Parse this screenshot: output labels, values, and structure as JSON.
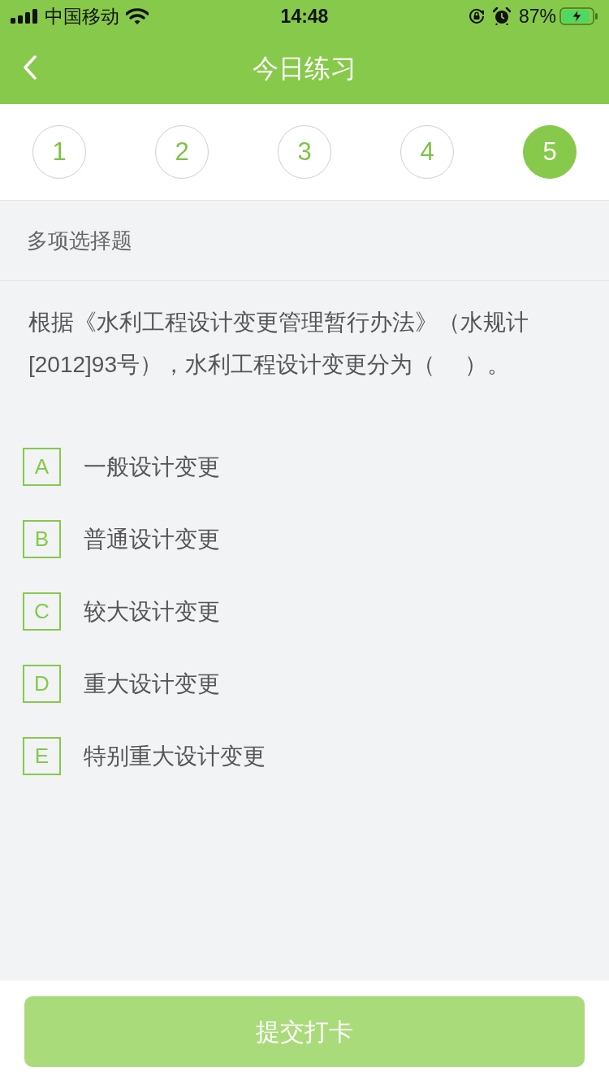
{
  "status_bar": {
    "carrier": "中国移动",
    "time": "14:48",
    "battery": "87%"
  },
  "nav": {
    "title": "今日练习"
  },
  "question_tabs": [
    {
      "label": "1",
      "selected": false
    },
    {
      "label": "2",
      "selected": false
    },
    {
      "label": "3",
      "selected": false
    },
    {
      "label": "4",
      "selected": false
    },
    {
      "label": "5",
      "selected": true
    }
  ],
  "question": {
    "type_label": "多项选择题",
    "text": "根据《水利工程设计变更管理暂行办法》（水规计[2012]93号），水利工程设计变更分为（　 ）。",
    "options": [
      {
        "letter": "A",
        "text": "一般设计变更",
        "selected": false
      },
      {
        "letter": "B",
        "text": "普通设计变更",
        "selected": false
      },
      {
        "letter": "C",
        "text": "较大设计变更",
        "selected": false
      },
      {
        "letter": "D",
        "text": "重大设计变更",
        "selected": false
      },
      {
        "letter": "E",
        "text": "特别重大设计变更",
        "selected": false
      }
    ]
  },
  "submit_button": {
    "label": "提交打卡",
    "disabled": true
  }
}
